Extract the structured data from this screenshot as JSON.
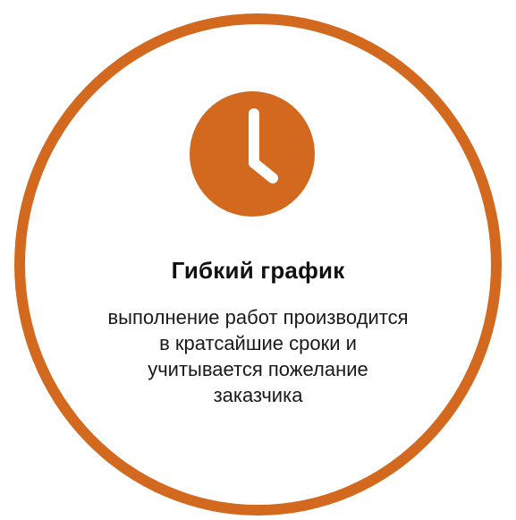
{
  "colors": {
    "accent": "#d2691e",
    "icon_foreground": "#ffffff",
    "title_text": "#111111",
    "body_text": "#1a1a1a"
  },
  "icon": "clock-icon",
  "title": "Гибкий график",
  "description_lines": [
    "выполнение работ производится",
    "в кратсайшие сроки и",
    "учитывается пожелание",
    "заказчика"
  ]
}
